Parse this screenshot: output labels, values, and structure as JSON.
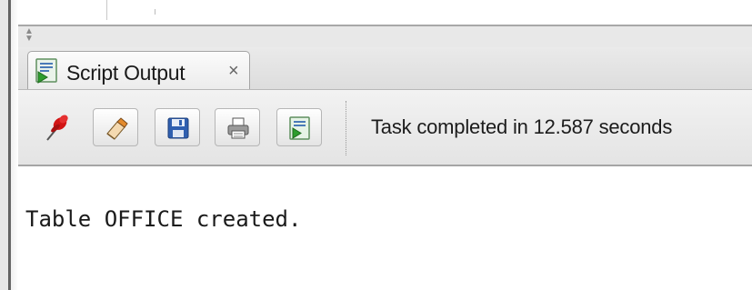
{
  "splitter": {
    "collapse_icon": "▲",
    "expand_icon": "▼"
  },
  "tab": {
    "icon": "script-run-icon",
    "label": "Script Output",
    "close_glyph": "×"
  },
  "toolbar": {
    "buttons": [
      {
        "name": "pin-icon"
      },
      {
        "name": "eraser-icon"
      },
      {
        "name": "save-icon"
      },
      {
        "name": "print-icon"
      },
      {
        "name": "script-run-icon"
      }
    ],
    "status": "Task completed in 12.587 seconds"
  },
  "output": {
    "lines": [
      "Table OFFICE created."
    ]
  },
  "colors": {
    "pin": "#d21414",
    "eraser": "#e38a2c",
    "save": "#2f5fb0",
    "script_green": "#2e9d2e"
  }
}
